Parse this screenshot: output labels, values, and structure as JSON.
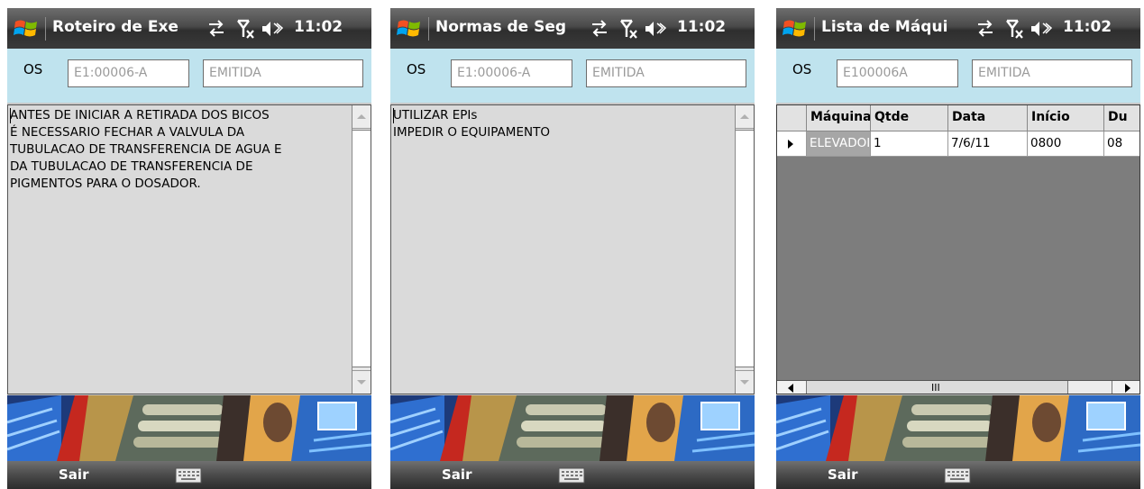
{
  "screens": [
    {
      "title": "Roteiro de Exe",
      "clock": "11:02",
      "os_label": "OS",
      "os_code": "E1:00006-A",
      "os_status": "EMITIDA",
      "text": "ANTES DE INICIAR A RETIRADA DOS BICOS\nÉ NECESSARIO FECHAR A VALVULA DA\nTUBULACAO DE TRANSFERENCIA DE AGUA E\nDA TUBULACAO DE TRANSFERENCIA DE\nPIGMENTOS PARA O DOSADOR.",
      "softkey_left": "Sair"
    },
    {
      "title": "Normas de Seg",
      "clock": "11:02",
      "os_label": "OS",
      "os_code": "E1:00006-A",
      "os_status": "EMITIDA",
      "text": "UTILIZAR EPIs\nIMPEDIR O EQUIPAMENTO",
      "softkey_left": "Sair"
    },
    {
      "title": "Lista de Máqui",
      "clock": "11:02",
      "os_label": "OS",
      "os_code": "E100006A",
      "os_status": "EMITIDA",
      "grid": {
        "columns": [
          "Máquina",
          "Qtde",
          "Data",
          "Início",
          "Du"
        ],
        "rows": [
          [
            "ELEVADOI",
            "1",
            "7/6/11",
            "0800",
            "08"
          ]
        ]
      },
      "hscroll_grip": "III",
      "softkey_left": "Sair"
    }
  ],
  "icons": {
    "start": "windows-flag-icon",
    "sync": "sync-arrows-icon",
    "signal": "no-signal-icon",
    "volume": "speaker-icon",
    "keyboard": "keyboard-icon"
  },
  "colors": {
    "osbar_bg": "#bfe3ee",
    "titlebar": "#3a3a3a",
    "textarea_bg": "#dadada",
    "grid_bg": "#7d7d7d"
  }
}
